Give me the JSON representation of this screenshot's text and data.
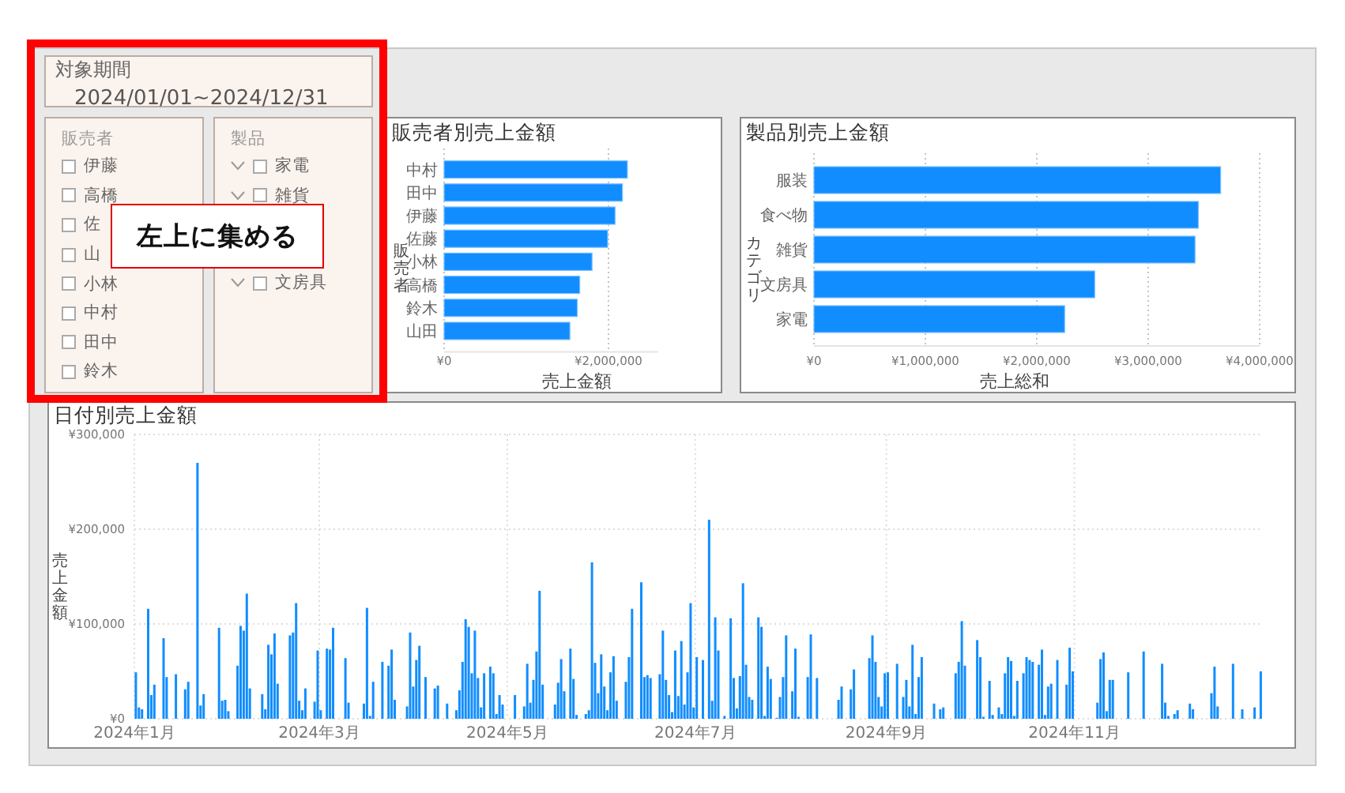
{
  "filters": {
    "date_range": {
      "title": "対象期間",
      "value": "2024/01/01~2024/12/31"
    },
    "slicers": [
      {
        "title": "販売者",
        "kind": "list",
        "items": [
          {
            "label": "伊藤",
            "checked": false
          },
          {
            "label": "高橋",
            "checked": false
          },
          {
            "label": "佐",
            "checked": false
          },
          {
            "label": "山",
            "checked": false
          },
          {
            "label": "小林",
            "checked": false
          },
          {
            "label": "中村",
            "checked": false
          },
          {
            "label": "田中",
            "checked": false
          },
          {
            "label": "鈴木",
            "checked": false
          }
        ]
      },
      {
        "title": "製品",
        "kind": "hierarchy",
        "items": [
          {
            "label": "家電",
            "checked": false
          },
          {
            "label": "雑貨",
            "checked": false
          },
          {
            "label": "文房具",
            "checked": false
          }
        ]
      }
    ]
  },
  "callout": {
    "text": "左上に集める"
  },
  "charts": [
    {
      "chart_data": {
        "type": "bar",
        "orientation": "horizontal",
        "title": "販売者別売上金額",
        "xlabel": "売上金額",
        "ylabel": "販売者",
        "categories": [
          "中村",
          "田中",
          "伊藤",
          "佐藤",
          "小林",
          "高橋",
          "鈴木",
          "山田"
        ],
        "grid": true,
        "xlim": [
          0,
          2600000
        ],
        "xticks": [
          {
            "value": 0,
            "label": "¥0"
          },
          {
            "value": 2000000,
            "label": "¥2,000,000"
          }
        ],
        "series": [
          {
            "color": "#118dff",
            "values": [
              2230000,
              2170000,
              2080000,
              1990000,
              1800000,
              1650000,
              1620000,
              1530000
            ]
          }
        ]
      }
    },
    {
      "chart_data": {
        "type": "bar",
        "orientation": "horizontal",
        "title": "製品別売上金額",
        "xlabel": "売上総和",
        "ylabel": "カテゴリ",
        "categories": [
          "服装",
          "食べ物",
          "雑貨",
          "文房具",
          "家電"
        ],
        "grid": true,
        "xlim": [
          0,
          4000000
        ],
        "xticks": [
          {
            "value": 0,
            "label": "¥0"
          },
          {
            "value": 1000000,
            "label": "¥1,000,000"
          },
          {
            "value": 2000000,
            "label": "¥2,000,000"
          },
          {
            "value": 3000000,
            "label": "¥3,000,000"
          },
          {
            "value": 4000000,
            "label": "¥4,000,000"
          }
        ],
        "series": [
          {
            "color": "#118dff",
            "values": [
              3650000,
              3450000,
              3420000,
              2520000,
              2250000
            ]
          }
        ]
      }
    },
    {
      "chart_data": {
        "type": "bar",
        "orientation": "vertical",
        "title": "日付別売上金額",
        "ylabel": "売上金額",
        "grid": true,
        "categories": [
          "2024年1月",
          null,
          null,
          null,
          null,
          null,
          null,
          null,
          null,
          null,
          null,
          null,
          null,
          null,
          null,
          null,
          null,
          null,
          null,
          null,
          null,
          null,
          null,
          null,
          null,
          null,
          null,
          null,
          null,
          null,
          null,
          null,
          null,
          null,
          null,
          null,
          null,
          null,
          null,
          null,
          null,
          null,
          null,
          null,
          null,
          null,
          null,
          null,
          null,
          null,
          null,
          null,
          null,
          null,
          null,
          null,
          null,
          null,
          null,
          null,
          "2024年3月",
          null,
          null,
          null,
          null,
          null,
          null,
          null,
          null,
          null,
          null,
          null,
          null,
          null,
          null,
          null,
          null,
          null,
          null,
          null,
          null,
          null,
          null,
          null,
          null,
          null,
          null,
          null,
          null,
          null,
          null,
          null,
          null,
          null,
          null,
          null,
          null,
          null,
          null,
          null,
          null,
          null,
          null,
          null,
          null,
          null,
          null,
          null,
          null,
          null,
          null,
          null,
          null,
          null,
          null,
          null,
          null,
          null,
          null,
          null,
          null,
          "2024年5月",
          null,
          null,
          null,
          null,
          null,
          null,
          null,
          null,
          null,
          null,
          null,
          null,
          null,
          null,
          null,
          null,
          null,
          null,
          null,
          null,
          null,
          null,
          null,
          null,
          null,
          null,
          null,
          null,
          null,
          null,
          null,
          null,
          null,
          null,
          null,
          null,
          null,
          null,
          null,
          null,
          null,
          null,
          null,
          null,
          null,
          null,
          null,
          null,
          null,
          null,
          null,
          null,
          null,
          null,
          null,
          null,
          null,
          null,
          null,
          null,
          "2024年7月",
          null,
          null,
          null,
          null,
          null,
          null,
          null,
          null,
          null,
          null,
          null,
          null,
          null,
          null,
          null,
          null,
          null,
          null,
          null,
          null,
          null,
          null,
          null,
          null,
          null,
          null,
          null,
          null,
          null,
          null,
          null,
          null,
          null,
          null,
          null,
          null,
          null,
          null,
          null,
          null,
          null,
          null,
          null,
          null,
          null,
          null,
          null,
          null,
          null,
          null,
          null,
          null,
          null,
          null,
          null,
          null,
          null,
          null,
          null,
          null,
          null,
          "2024年9月",
          null,
          null,
          null,
          null,
          null,
          null,
          null,
          null,
          null,
          null,
          null,
          null,
          null,
          null,
          null,
          null,
          null,
          null,
          null,
          null,
          null,
          null,
          null,
          null,
          null,
          null,
          null,
          null,
          null,
          null,
          null,
          null,
          null,
          null,
          null,
          null,
          null,
          null,
          null,
          null,
          null,
          null,
          null,
          null,
          null,
          null,
          null,
          null,
          null,
          null,
          null,
          null,
          null,
          null,
          null,
          null,
          null,
          null,
          null,
          null,
          "2024年11月",
          null,
          null,
          null,
          null,
          null,
          null,
          null,
          null,
          null,
          null,
          null,
          null,
          null,
          null,
          null,
          null,
          null,
          null,
          null,
          null,
          null,
          null,
          null,
          null,
          null,
          null,
          null,
          null,
          null,
          null,
          null,
          null,
          null,
          null,
          null,
          null,
          null,
          null,
          null,
          null,
          null,
          null,
          null,
          null,
          null,
          null,
          null,
          null,
          null,
          null,
          null,
          null,
          null,
          null,
          null,
          null,
          null,
          null,
          null,
          null
        ],
        "ylim": [
          0,
          300000
        ],
        "yticks": [
          {
            "value": 0,
            "label": "¥0"
          },
          {
            "value": 100000,
            "label": "¥100,000"
          },
          {
            "value": 200000,
            "label": "¥200,000"
          },
          {
            "value": 300000,
            "label": "¥300,000"
          }
        ],
        "series": [
          {
            "color": "#118dff",
            "values": [
              49000,
              12000,
              10000,
              null,
              116000,
              25000,
              36000,
              null,
              null,
              85000,
              44000,
              null,
              null,
              47000,
              null,
              null,
              31000,
              39000,
              null,
              null,
              270000,
              14000,
              26000,
              null,
              null,
              null,
              null,
              96000,
              19000,
              20000,
              8000,
              null,
              null,
              56000,
              98000,
              93000,
              132000,
              32000,
              null,
              null,
              null,
              26000,
              10000,
              78000,
              68000,
              90000,
              37000,
              null,
              null,
              null,
              88000,
              91000,
              122000,
              19000,
              9000,
              32000,
              null,
              null,
              18000,
              72000,
              9000,
              null,
              74000,
              73000,
              96000,
              null,
              null,
              null,
              64000,
              17000,
              null,
              null,
              null,
              null,
              16000,
              117000,
              3000,
              39000,
              null,
              null,
              60000,
              null,
              56000,
              73000,
              20000,
              null,
              null,
              null,
              13000,
              91000,
              34000,
              62000,
              77000,
              null,
              44000,
              null,
              null,
              32000,
              35000,
              null,
              null,
              16000,
              null,
              null,
              9000,
              30000,
              60000,
              105000,
              97000,
              48000,
              93000,
              43000,
              12000,
              48000,
              null,
              55000,
              48000,
              5000,
              25000,
              15000,
              null,
              null,
              null,
              25000,
              null,
              null,
              13000,
              58000,
              17000,
              41000,
              71000,
              135000,
              36000,
              null,
              null,
              null,
              15000,
              38000,
              63000,
              29000,
              null,
              74000,
              42000,
              4000,
              null,
              null,
              5000,
              9000,
              165000,
              59000,
              27000,
              68000,
              34000,
              9000,
              49000,
              66000,
              19000,
              null,
              null,
              39000,
              65000,
              116000,
              null,
              null,
              144000,
              44000,
              46000,
              43000,
              null,
              null,
              47000,
              93000,
              41000,
              25000,
              7000,
              72000,
              24000,
              82000,
              15000,
              49000,
              122000,
              12000,
              65000,
              null,
              62000,
              null,
              210000,
              19000,
              107000,
              72000,
              null,
              3000,
              null,
              106000,
              43000,
              11000,
              45000,
              143000,
              57000,
              23000,
              20000,
              null,
              107000,
              97000,
              3000,
              55000,
              42000,
              null,
              1000,
              23000,
              44000,
              88000,
              null,
              29000,
              74000,
              2000,
              null,
              null,
              44000,
              89000,
              null,
              43000,
              null,
              null,
              null,
              null,
              null,
              null,
              20000,
              34000,
              null,
              null,
              31000,
              52000,
              null,
              null,
              null,
              null,
              64000,
              88000,
              60000,
              23000,
              13000,
              48000,
              49000,
              null,
              null,
              58000,
              null,
              23000,
              41000,
              13000,
              78000,
              5000,
              44000,
              65000,
              null,
              null,
              null,
              16000,
              null,
              10000,
              12000,
              null,
              null,
              null,
              48000,
              60000,
              103000,
              56000,
              null,
              null,
              null,
              83000,
              65000,
              2000,
              null,
              40000,
              4000,
              null,
              12000,
              5000,
              48000,
              65000,
              61000,
              3000,
              40000,
              null,
              48000,
              65000,
              62000,
              60000,
              null,
              57000,
              73000,
              4000,
              34000,
              37000,
              null,
              62000,
              null,
              null,
              36000,
              75000,
              50000,
              null,
              null,
              null,
              null,
              null,
              null,
              null,
              17000,
              63000,
              70000,
              8000,
              41000,
              41000,
              null,
              null,
              null,
              null,
              49000,
              null,
              null,
              null,
              null,
              71000,
              null,
              null,
              null,
              null,
              null,
              58000,
              17000,
              3000,
              null,
              5000,
              9000,
              null,
              null,
              null,
              16000,
              10000,
              null,
              null,
              null,
              null,
              null,
              27000,
              55000,
              13000,
              null,
              null,
              null,
              null,
              58000,
              null,
              null,
              10000,
              null,
              null,
              null,
              12000,
              null,
              50000
            ]
          }
        ]
      }
    }
  ]
}
